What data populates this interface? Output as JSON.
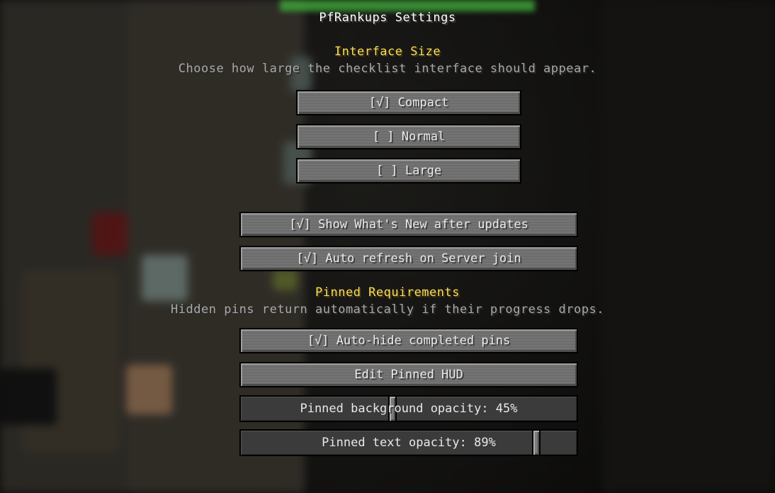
{
  "screen": {
    "title": "PfRankups Settings"
  },
  "interface_size": {
    "heading": "Interface Size",
    "description": "Choose how large the checklist interface should appear.",
    "options": [
      {
        "label": "[√] Compact",
        "checked": true
      },
      {
        "label": "[ ] Normal",
        "checked": false
      },
      {
        "label": "[ ] Large",
        "checked": false
      }
    ]
  },
  "general": {
    "show_whats_new": "[√] Show What's New after updates",
    "auto_refresh": "[√] Auto refresh on Server join"
  },
  "pinned": {
    "heading": "Pinned Requirements",
    "description": "Hidden pins return automatically if their progress drops.",
    "auto_hide": "[√] Auto-hide completed pins",
    "edit_hud": "Edit Pinned HUD",
    "bg_opacity": {
      "label": "Pinned background opacity: 45%",
      "value": 0.45
    },
    "text_opacity": {
      "label": "Pinned text opacity: 89%",
      "value": 0.89
    }
  },
  "colors": {
    "heading": "#ffdd55",
    "title": "#ffffff",
    "description": "#a9a9a9",
    "button": "#707070",
    "slider_track": "#3b3b3b"
  }
}
